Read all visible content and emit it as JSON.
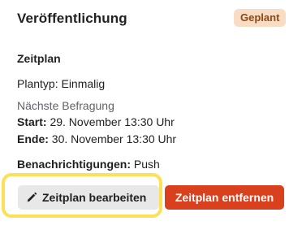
{
  "header": {
    "title": "Veröffentlichung",
    "badge": "Geplant"
  },
  "colors": {
    "badge_bg": "#f9dcc4",
    "badge_text": "#8a4a16",
    "danger": "#d9411e",
    "focus": "#fbe158"
  },
  "schedule": {
    "section_title": "Zeitplan",
    "plan_type_label": "Plantyp:",
    "plan_type_value": "Einmalig",
    "next_survey_heading": "Nächste Befragung",
    "start_label": "Start:",
    "start_value": "29. November 13:30 Uhr",
    "end_label": "Ende:",
    "end_value": "30. November 13:30 Uhr",
    "notifications_label": "Benachrichtigungen:",
    "notifications_value": "Push"
  },
  "actions": {
    "edit_label": "Zeitplan bearbeiten",
    "edit_icon": "pencil-icon",
    "remove_label": "Zeitplan entfernen"
  }
}
